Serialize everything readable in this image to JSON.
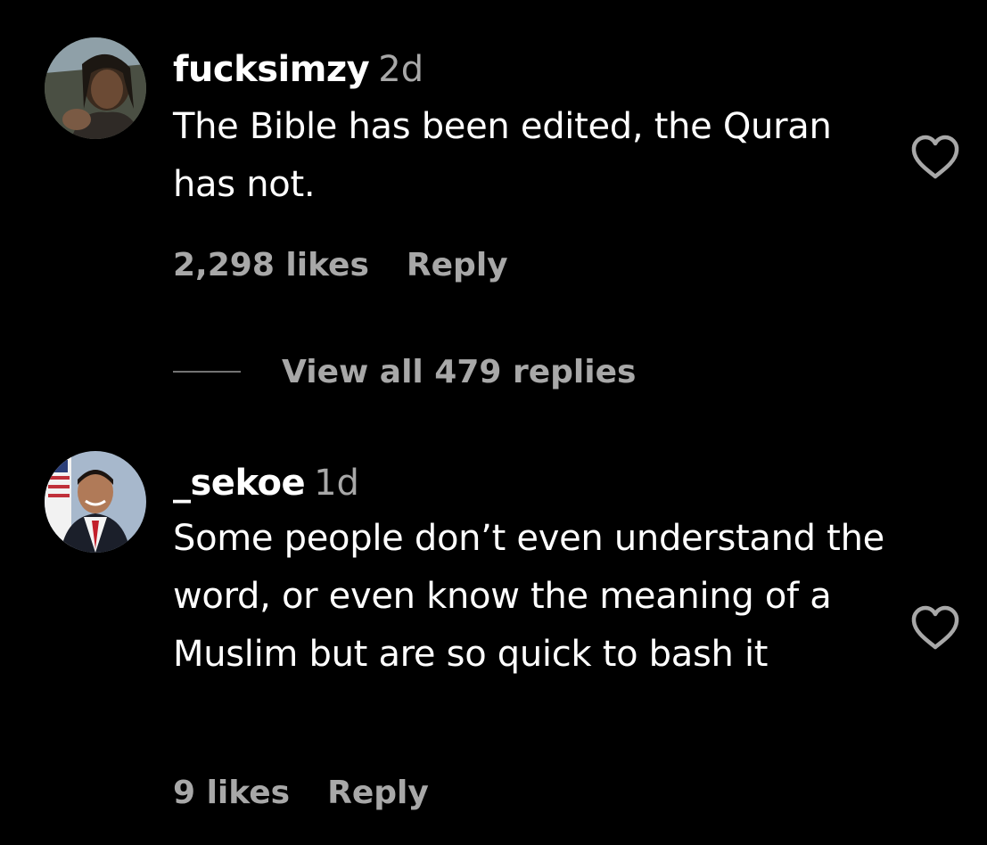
{
  "comments": [
    {
      "username": "fucksimzy",
      "time": "2d",
      "text": "The Bible has been edited, the Quran has not.",
      "likes": "2,298 likes",
      "reply": "Reply",
      "view_replies": "View all 479 replies",
      "avatar_icon": "profile-photo"
    },
    {
      "username": "_sekoe",
      "time": "1d",
      "text": "Some people don’t even understand the word, or even know the meaning of a Muslim but are so quick to bash it",
      "likes": "9 likes",
      "reply": "Reply",
      "avatar_icon": "profile-photo"
    }
  ],
  "icons": {
    "like": "heart-outline-icon"
  },
  "colors": {
    "background": "#000000",
    "primary_text": "#ffffff",
    "secondary_text": "#a8a8a8"
  }
}
